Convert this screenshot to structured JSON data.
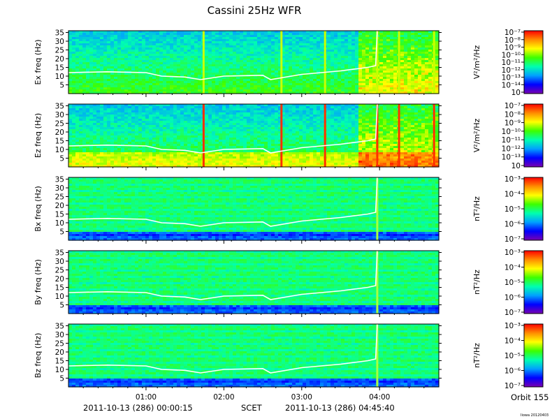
{
  "title": "Cassini 25Hz WFR",
  "colors": {
    "background": "#ffffff",
    "trace": "#ffffff",
    "colormap": [
      "#7a00b0",
      "#0000ff",
      "#00a0ff",
      "#00ffb0",
      "#3cff00",
      "#ffff00",
      "#ff8c00",
      "#ff0000"
    ]
  },
  "footer": {
    "start_time": "2011-10-13 (286) 00:00:15",
    "scet_label": "SCET",
    "end_time": "2011-10-13 (286) 04:45:40",
    "orbit": "Orbit 155",
    "version": "Iiowa 20120403"
  },
  "chart_data": [
    {
      "type": "heatmap",
      "ylabel": "Ex freq (Hz)",
      "yticks": [
        5,
        10,
        15,
        20,
        25,
        30,
        35
      ],
      "ylim": [
        0,
        36
      ],
      "xticks": [
        "01:00",
        "02:00",
        "03:00",
        "04:00"
      ],
      "x_hours": [
        1,
        2,
        3,
        4
      ],
      "xlim_hours": [
        0.004,
        4.761
      ],
      "colorbar": {
        "ticks": [
          "10⁻⁷",
          "10⁻⁸",
          "10⁻⁹",
          "10⁻¹⁰",
          "10⁻¹¹",
          "10⁻¹²",
          "10⁻¹³",
          "10⁻¹⁴",
          "10"
        ],
        "unit": "V²/m²/Hz"
      },
      "bursts_hours": [
        1.74,
        2.74,
        3.3,
        3.97,
        4.25,
        4.7
      ],
      "trace": {
        "x_hours": [
          0,
          0.5,
          1.0,
          1.2,
          1.5,
          1.7,
          2.0,
          2.5,
          2.6,
          3.0,
          3.5,
          3.85,
          3.95,
          3.97
        ],
        "y_hz": [
          12,
          12.5,
          12,
          10,
          9.5,
          8,
          10,
          10.5,
          8,
          11,
          13,
          15,
          16,
          36
        ]
      }
    },
    {
      "type": "heatmap",
      "ylabel": "Ez freq (Hz)",
      "yticks": [
        5,
        10,
        15,
        20,
        25,
        30,
        35
      ],
      "ylim": [
        0,
        36
      ],
      "xticks": [
        "01:00",
        "02:00",
        "03:00",
        "04:00"
      ],
      "x_hours": [
        1,
        2,
        3,
        4
      ],
      "xlim_hours": [
        0.004,
        4.761
      ],
      "colorbar": {
        "ticks": [
          "10⁻⁷",
          "10⁻⁸",
          "10⁻⁹",
          "10⁻¹⁰",
          "10⁻¹¹",
          "10⁻¹²",
          "10⁻¹³",
          "10"
        ],
        "unit": "V²/m²/Hz"
      },
      "bursts_hours": [
        1.74,
        2.74,
        3.3,
        3.97,
        4.25,
        4.7
      ],
      "trace": {
        "x_hours": [
          0,
          0.5,
          1.0,
          1.2,
          1.5,
          1.7,
          2.0,
          2.5,
          2.6,
          3.0,
          3.5,
          3.85,
          3.95,
          3.97
        ],
        "y_hz": [
          12,
          12.5,
          12,
          10,
          9.5,
          8,
          10,
          10.5,
          8,
          11,
          13,
          15,
          16,
          36
        ]
      }
    },
    {
      "type": "heatmap",
      "ylabel": "Bx freq (Hz)",
      "yticks": [
        5,
        10,
        15,
        20,
        25,
        30,
        35
      ],
      "ylim": [
        0,
        36
      ],
      "xticks": [
        "01:00",
        "02:00",
        "03:00",
        "04:00"
      ],
      "x_hours": [
        1,
        2,
        3,
        4
      ],
      "xlim_hours": [
        0.004,
        4.761
      ],
      "colorbar": {
        "ticks": [
          "10⁻³",
          "10⁻⁴",
          "10⁻⁵",
          "10⁻⁶",
          "10⁻⁷"
        ],
        "unit": "nT²/Hz"
      },
      "bursts_hours": [
        3.97
      ],
      "trace": {
        "x_hours": [
          0,
          0.5,
          1.0,
          1.2,
          1.5,
          1.7,
          2.0,
          2.5,
          2.6,
          3.0,
          3.5,
          3.85,
          3.95,
          3.97
        ],
        "y_hz": [
          12,
          12.5,
          12,
          10,
          9.5,
          8,
          10,
          10.5,
          8,
          11,
          13,
          15,
          16,
          36
        ]
      }
    },
    {
      "type": "heatmap",
      "ylabel": "By freq (Hz)",
      "yticks": [
        5,
        10,
        15,
        20,
        25,
        30,
        35
      ],
      "ylim": [
        0,
        36
      ],
      "xticks": [
        "01:00",
        "02:00",
        "03:00",
        "04:00"
      ],
      "x_hours": [
        1,
        2,
        3,
        4
      ],
      "xlim_hours": [
        0.004,
        4.761
      ],
      "colorbar": {
        "ticks": [
          "10⁻³",
          "10⁻⁴",
          "10⁻⁵",
          "10⁻⁶",
          "10⁻⁷"
        ],
        "unit": "nT²/Hz"
      },
      "bursts_hours": [
        3.97
      ],
      "trace": {
        "x_hours": [
          0,
          0.5,
          1.0,
          1.2,
          1.5,
          1.7,
          2.0,
          2.5,
          2.6,
          3.0,
          3.5,
          3.85,
          3.95,
          3.97
        ],
        "y_hz": [
          12,
          12.5,
          12,
          10,
          9.5,
          8,
          10,
          10.5,
          8,
          11,
          13,
          15,
          16,
          36
        ]
      }
    },
    {
      "type": "heatmap",
      "ylabel": "Bz freq (Hz)",
      "yticks": [
        5,
        10,
        15,
        20,
        25,
        30,
        35
      ],
      "ylim": [
        0,
        36
      ],
      "xticks": [
        "01:00",
        "02:00",
        "03:00",
        "04:00"
      ],
      "x_hours": [
        1,
        2,
        3,
        4
      ],
      "xlim_hours": [
        0.004,
        4.761
      ],
      "colorbar": {
        "ticks": [
          "10⁻³",
          "10⁻⁴",
          "10⁻⁵",
          "10⁻⁶",
          "10⁻⁷"
        ],
        "unit": "nT²/Hz"
      },
      "bursts_hours": [
        3.97
      ],
      "trace": {
        "x_hours": [
          0,
          0.5,
          1.0,
          1.2,
          1.5,
          1.7,
          2.0,
          2.5,
          2.6,
          3.0,
          3.5,
          3.85,
          3.95,
          3.97
        ],
        "y_hz": [
          12,
          12.5,
          12,
          10,
          9.5,
          8,
          10,
          10.5,
          8,
          11,
          13,
          15,
          16,
          36
        ]
      }
    }
  ]
}
